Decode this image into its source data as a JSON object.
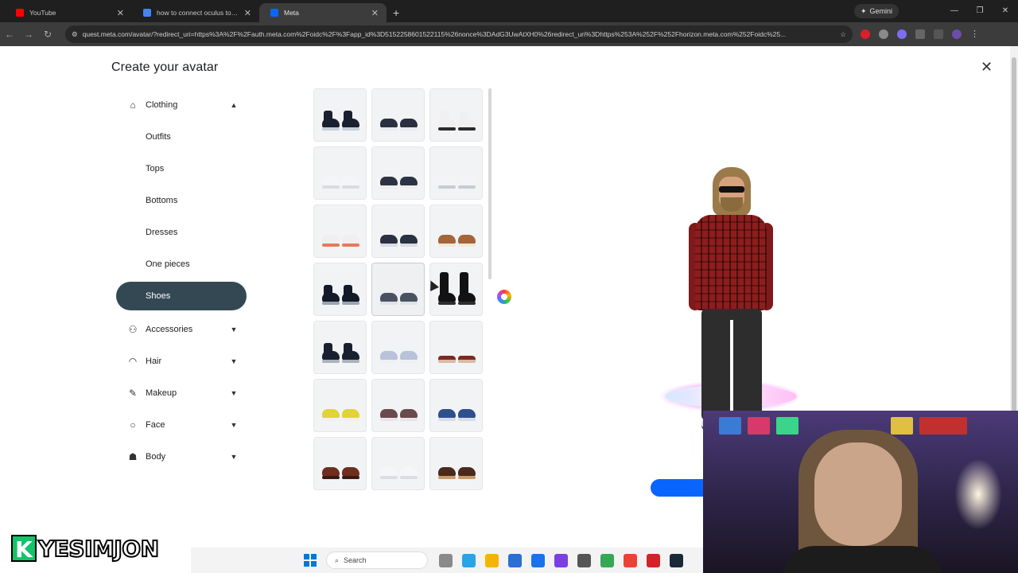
{
  "browser": {
    "tabs": [
      {
        "label": "YouTube",
        "favicon_color": "#ff0000",
        "active": false
      },
      {
        "label": "how to connect oculus to obs s",
        "favicon_color": "#4285f4",
        "active": false
      },
      {
        "label": "Meta",
        "favicon_color": "#0866ff",
        "active": true
      }
    ],
    "new_tab_label": "+",
    "gemini_label": "Gemini",
    "url": "quest.meta.com/avatar/?redirect_uri=https%3A%2F%2Fauth.meta.com%2Foidc%2F%3Fapp_id%3D5152258601522115%26nonce%3DAdG3UwAtXH0%26redirect_uri%3Dhttps%253A%252F%252Fhorizon.meta.com%252Foidc%25..."
  },
  "page": {
    "title": "Create your avatar",
    "close_icon": "close-icon"
  },
  "sidebar": {
    "clothing": {
      "label": "Clothing",
      "icon": "hanger-icon",
      "expanded": true
    },
    "clothing_items": [
      {
        "label": "Outfits",
        "selected": false
      },
      {
        "label": "Tops",
        "selected": false
      },
      {
        "label": "Bottoms",
        "selected": false
      },
      {
        "label": "Dresses",
        "selected": false
      },
      {
        "label": "One pieces",
        "selected": false
      },
      {
        "label": "Shoes",
        "selected": true
      }
    ],
    "categories": [
      {
        "label": "Accessories",
        "icon": "glasses-icon"
      },
      {
        "label": "Hair",
        "icon": "hair-icon"
      },
      {
        "label": "Makeup",
        "icon": "brush-icon"
      },
      {
        "label": "Face",
        "icon": "face-icon"
      },
      {
        "label": "Body",
        "icon": "body-icon"
      }
    ],
    "selected_color": "#344854"
  },
  "shoes": [
    {
      "color": "#1b2030",
      "accent": "#c8cfd8",
      "style": "boot"
    },
    {
      "color": "#2b3040",
      "accent": "#e8ecf0",
      "style": "sneaker"
    },
    {
      "color": "#f0f0f0",
      "accent": "#2a2a2a",
      "style": "boot"
    },
    {
      "color": "#f4f5f7",
      "accent": "#d8dce2",
      "style": "sneaker"
    },
    {
      "color": "#2c3342",
      "accent": "#eeeeee",
      "style": "sneaker"
    },
    {
      "color": "#f2f4f6",
      "accent": "#c6ccd4",
      "style": "sneaker"
    },
    {
      "color": "#f0eeee",
      "accent": "#e57a5a",
      "style": "sneaker"
    },
    {
      "color": "#2a3140",
      "accent": "#d8dde4",
      "style": "sneaker"
    },
    {
      "color": "#a5653a",
      "accent": "#f1e8dc",
      "style": "sneaker"
    },
    {
      "color": "#141a28",
      "accent": "#9aa4b2",
      "style": "boot"
    },
    {
      "color": "#4a5262",
      "accent": "#dfe3e8",
      "style": "sneaker"
    },
    {
      "color": "#121212",
      "accent": "#2e2e2e",
      "style": "tallboot"
    },
    {
      "color": "#1a2030",
      "accent": "#aab2be",
      "style": "boot"
    },
    {
      "color": "#b9c2d8",
      "accent": "#eef0f6",
      "style": "sneaker"
    },
    {
      "color": "#7a2a22",
      "accent": "#d9b9a6",
      "style": "sandal"
    },
    {
      "color": "#e0d436",
      "accent": "#f1f1e8",
      "style": "sneaker"
    },
    {
      "color": "#6a4a4e",
      "accent": "#e8e4ea",
      "style": "sneaker"
    },
    {
      "color": "#2f4e8e",
      "accent": "#d8dcea",
      "style": "sneaker"
    },
    {
      "color": "#6e2e1e",
      "accent": "#3a1a10",
      "style": "dress"
    },
    {
      "color": "#f6f6f8",
      "accent": "#dcdde4",
      "style": "sneaker"
    },
    {
      "color": "#4a2a1a",
      "accent": "#c89a6a",
      "style": "dress"
    }
  ],
  "hovered_shoe_index": 10,
  "loading_icon": "spinner-icon",
  "overlay": {
    "logo_letter": "K",
    "logo_text": "YESIMJON"
  },
  "taskbar": {
    "search_label": "Search",
    "icons": [
      {
        "name": "files-icon",
        "color": "#8a8a8a"
      },
      {
        "name": "copilot-icon",
        "color": "#2aa4e8"
      },
      {
        "name": "file-explorer-icon",
        "color": "#f4b400"
      },
      {
        "name": "store-icon",
        "color": "#2b6ed6"
      },
      {
        "name": "mail-icon",
        "color": "#1a73e8"
      },
      {
        "name": "app-icon",
        "color": "#7b3fe4"
      },
      {
        "name": "app-icon-2",
        "color": "#555"
      },
      {
        "name": "chrome-icon",
        "color": "#34a853"
      },
      {
        "name": "maps-icon",
        "color": "#ea4335"
      },
      {
        "name": "opera-icon",
        "color": "#d6202a"
      },
      {
        "name": "steam-icon",
        "color": "#1b2838"
      }
    ]
  }
}
